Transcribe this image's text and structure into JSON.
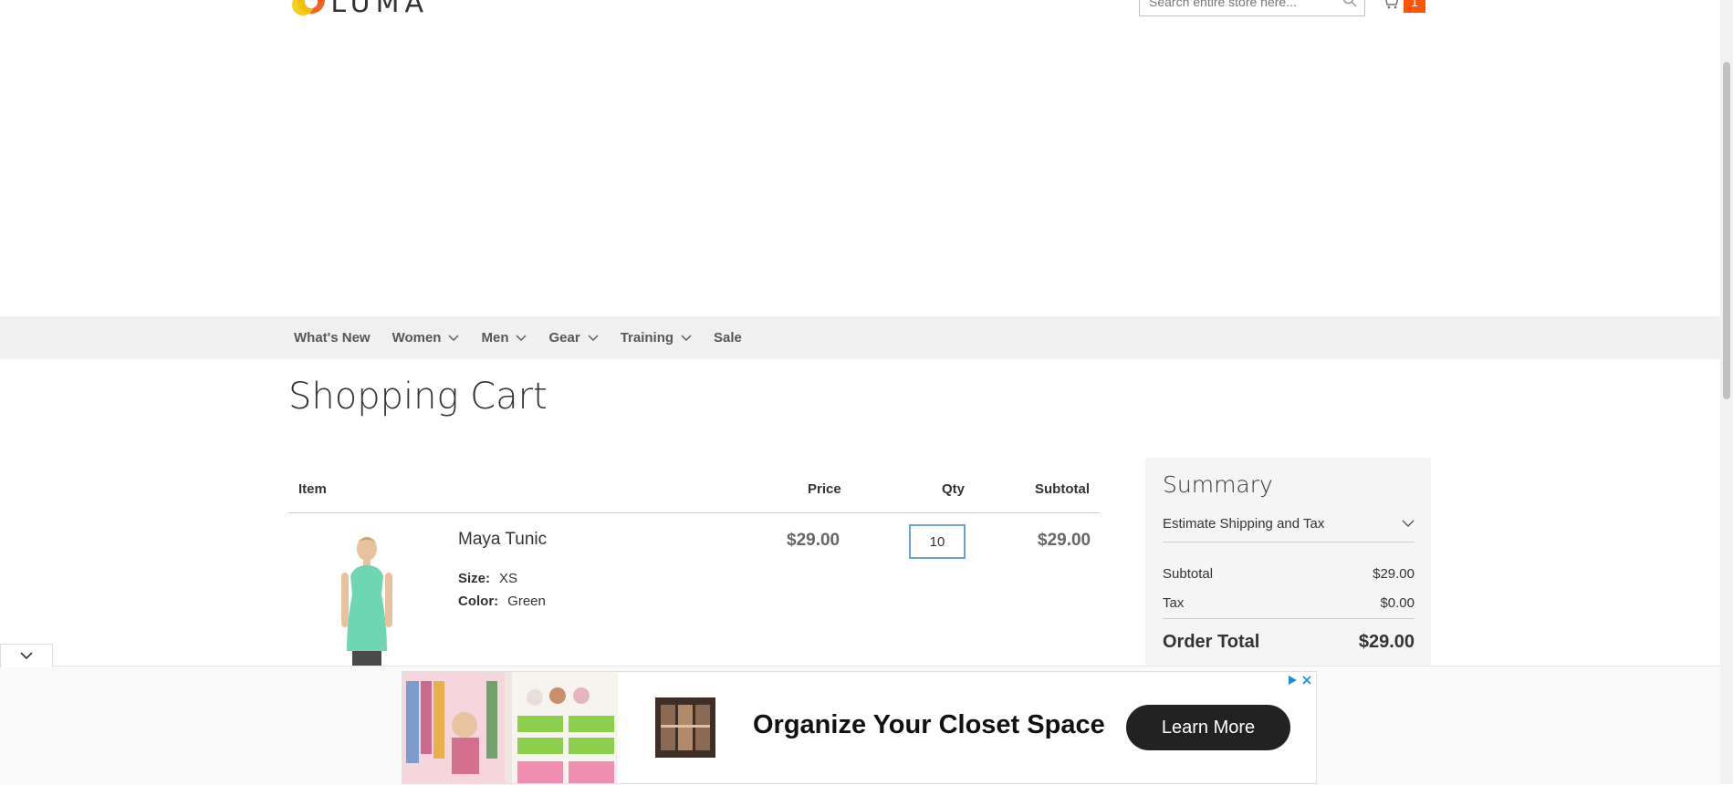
{
  "header": {
    "logo_text": "LUMA",
    "search_placeholder": "Search entire store here...",
    "cart_count": "1"
  },
  "nav": {
    "items": [
      {
        "label": "What's New",
        "has_dropdown": false
      },
      {
        "label": "Women",
        "has_dropdown": true
      },
      {
        "label": "Men",
        "has_dropdown": true
      },
      {
        "label": "Gear",
        "has_dropdown": true
      },
      {
        "label": "Training",
        "has_dropdown": true
      },
      {
        "label": "Sale",
        "has_dropdown": false
      }
    ]
  },
  "page": {
    "title": "Shopping Cart"
  },
  "cart": {
    "headers": {
      "item": "Item",
      "price": "Price",
      "qty": "Qty",
      "subtotal": "Subtotal"
    },
    "items": [
      {
        "name": "Maya Tunic",
        "options": [
          {
            "label": "Size:",
            "value": "XS"
          },
          {
            "label": "Color:",
            "value": "Green"
          }
        ],
        "price": "$29.00",
        "qty": "10",
        "subtotal": "$29.00"
      }
    ]
  },
  "summary": {
    "title": "Summary",
    "estimate_label": "Estimate Shipping and Tax",
    "subtotal_label": "Subtotal",
    "subtotal_value": "$29.00",
    "tax_label": "Tax",
    "tax_value": "$0.00",
    "total_label": "Order Total",
    "total_value": "$29.00"
  },
  "ad": {
    "headline": "Organize Your Closet Space",
    "button_label": "Learn More"
  },
  "colors": {
    "accent": "#ff5501",
    "nav_bg": "#f0f0f0",
    "summary_bg": "#f5f5f5",
    "ad_button": "#222222"
  }
}
